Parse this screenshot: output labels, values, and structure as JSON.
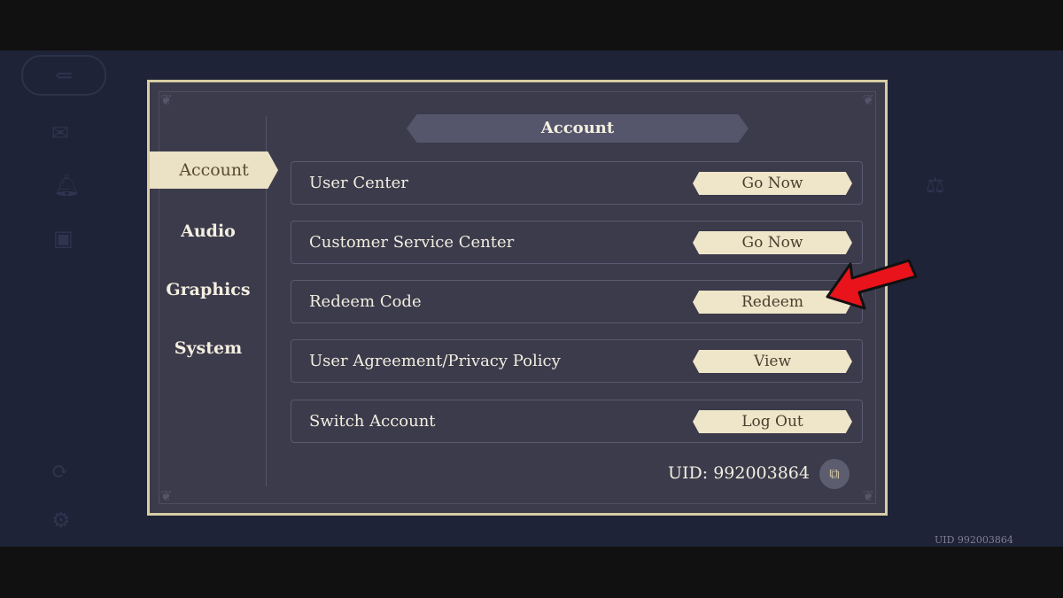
{
  "panel": {
    "title": "Account"
  },
  "tabs": [
    {
      "label": "Account",
      "active": true
    },
    {
      "label": "Audio",
      "active": false
    },
    {
      "label": "Graphics",
      "active": false
    },
    {
      "label": "System",
      "active": false
    }
  ],
  "rows": [
    {
      "label": "User Center",
      "button": "Go Now"
    },
    {
      "label": "Customer Service Center",
      "button": "Go Now"
    },
    {
      "label": "Redeem Code",
      "button": "Redeem"
    },
    {
      "label": "User Agreement/Privacy Policy",
      "button": "View"
    },
    {
      "label": "Switch Account",
      "button": "Log Out"
    }
  ],
  "uid": {
    "label": "UID: 992003864",
    "background_label": "UID 992003864"
  },
  "annotation": {
    "icon": "red-arrow-icon",
    "color": "#e8131b",
    "target": "Redeem"
  },
  "colors": {
    "accent": "#ebe1c4",
    "panel": "#3b3b4b",
    "border": "#d8cda3",
    "background": "#1e2337"
  }
}
